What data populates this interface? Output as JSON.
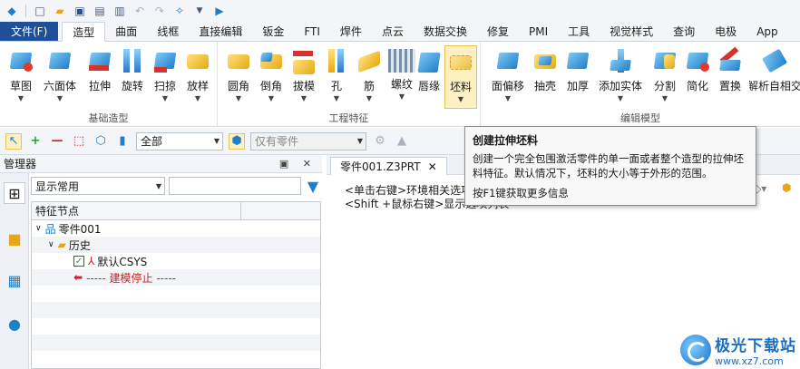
{
  "tabs": [
    {
      "id": "file",
      "label": "文件(F)"
    },
    {
      "id": "modeling",
      "label": "造型"
    },
    {
      "id": "surface",
      "label": "曲面"
    },
    {
      "id": "wireframe",
      "label": "线框"
    },
    {
      "id": "direct",
      "label": "直接编辑"
    },
    {
      "id": "sheetmetal",
      "label": "钣金"
    },
    {
      "id": "fti",
      "label": "FTI"
    },
    {
      "id": "weld",
      "label": "焊件"
    },
    {
      "id": "pointcloud",
      "label": "点云"
    },
    {
      "id": "dataexchange",
      "label": "数据交换"
    },
    {
      "id": "repair",
      "label": "修复"
    },
    {
      "id": "pmi",
      "label": "PMI"
    },
    {
      "id": "tools",
      "label": "工具"
    },
    {
      "id": "visual",
      "label": "视觉样式"
    },
    {
      "id": "query",
      "label": "查询"
    },
    {
      "id": "electrode",
      "label": "电极"
    },
    {
      "id": "app",
      "label": "App"
    }
  ],
  "ribbon": {
    "groups": {
      "basic": "基础造型",
      "engineering": "工程特征",
      "editing": "编辑模型"
    },
    "basic_buttons": [
      {
        "name": "sketch",
        "label": "草图"
      },
      {
        "name": "hexahedron",
        "label": "六面体"
      },
      {
        "name": "extrude",
        "label": "拉伸"
      },
      {
        "name": "revolve",
        "label": "旋转"
      },
      {
        "name": "sweep",
        "label": "扫掠"
      },
      {
        "name": "loft",
        "label": "放样"
      }
    ],
    "engineering_buttons": [
      {
        "name": "fillet",
        "label": "圆角"
      },
      {
        "name": "chamfer",
        "label": "倒角"
      },
      {
        "name": "draft",
        "label": "拔模"
      },
      {
        "name": "hole",
        "label": "孔"
      },
      {
        "name": "rib",
        "label": "筋"
      },
      {
        "name": "thread",
        "label": "螺纹"
      },
      {
        "name": "lip",
        "label": "唇缘"
      },
      {
        "name": "stock",
        "label": "坯料"
      }
    ],
    "editing_buttons": [
      {
        "name": "offset-face",
        "label": "面偏移"
      },
      {
        "name": "shell",
        "label": "抽壳"
      },
      {
        "name": "thicken",
        "label": "加厚"
      },
      {
        "name": "add-solid",
        "label": "添加实体"
      },
      {
        "name": "split",
        "label": "分割"
      },
      {
        "name": "simplify",
        "label": "简化"
      },
      {
        "name": "replace",
        "label": "置换"
      },
      {
        "name": "parse",
        "label": "解析自相交"
      }
    ]
  },
  "toolbar2": {
    "filter_value": "全部",
    "part_value": "仅有零件"
  },
  "manager": {
    "title": "管理器",
    "display_select": "显示常用",
    "tree_header": "特征节点",
    "nodes": {
      "part": "零件001",
      "history": "历史",
      "csys": "默认CSYS",
      "stop": "----- 建模停止 -----"
    }
  },
  "document": {
    "tab_label": "零件001.Z3PRT",
    "hint1": "<单击右键>环境相关选项",
    "hint2": "<Shift +鼠标右键>显示选项列表"
  },
  "tooltip": {
    "title": "创建拉伸坯料",
    "desc": "创建一个完全包围激活零件的单一面或者整个造型的拉伸坯料特征。默认情况下，坯料的大小等于外形的范围。",
    "help": "按F1键获取更多信息"
  },
  "watermark": {
    "name": "极光下载站",
    "url": "www.xz7.com"
  },
  "colors": {
    "file_tab": "#1e4f99",
    "accent_blue": "#1f7fc8",
    "stop_red": "#d62020"
  }
}
